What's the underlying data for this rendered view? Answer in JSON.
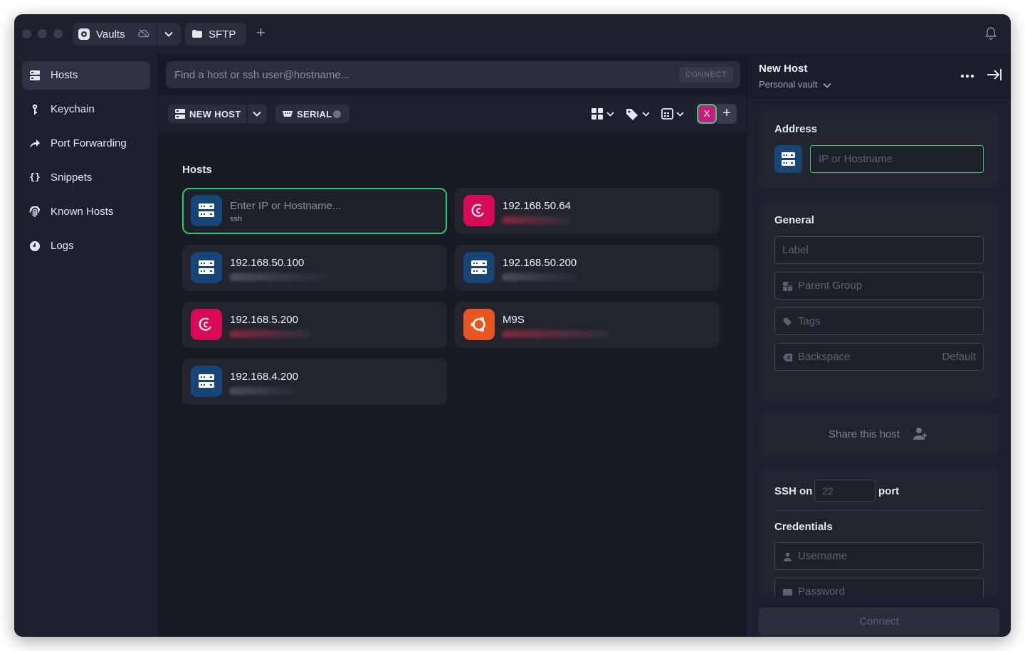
{
  "titlebar": {
    "tabs": [
      {
        "label": "Vaults",
        "icon": "vault-icon"
      },
      {
        "label": "SFTP",
        "icon": "folder-icon"
      }
    ]
  },
  "sidebar": {
    "items": [
      {
        "label": "Hosts",
        "icon": "server-icon",
        "active": true
      },
      {
        "label": "Keychain",
        "icon": "key-icon"
      },
      {
        "label": "Port Forwarding",
        "icon": "forward-arrow-icon"
      },
      {
        "label": "Snippets",
        "icon": "braces-icon"
      },
      {
        "label": "Known Hosts",
        "icon": "fingerprint-icon"
      },
      {
        "label": "Logs",
        "icon": "clock-icon"
      }
    ]
  },
  "search": {
    "placeholder": "Find a host or ssh user@hostname...",
    "connect_label": "CONNECT"
  },
  "toolbar": {
    "new_host_label": "NEW HOST",
    "serial_label": "SERIAL",
    "avatar_letter": "X"
  },
  "hosts_section": {
    "title": "Hosts",
    "cards": [
      {
        "title": "Enter IP or Hostname...",
        "subtitle": "ssh",
        "os": "server",
        "focused": true
      },
      {
        "title": "192.168.50.64",
        "subtitle": "",
        "os": "debian",
        "focused": false
      },
      {
        "title": "192.168.50.100",
        "subtitle": "",
        "os": "server",
        "focused": false
      },
      {
        "title": "192.168.50.200",
        "subtitle": "",
        "os": "server",
        "focused": false
      },
      {
        "title": "192.168.5.200",
        "subtitle": "",
        "os": "debian",
        "focused": false
      },
      {
        "title": "M9S",
        "subtitle": "",
        "os": "ubuntu",
        "focused": false
      },
      {
        "title": "192.168.4.200",
        "subtitle": "",
        "os": "server",
        "focused": false
      }
    ]
  },
  "panel": {
    "title": "New Host",
    "vault": "Personal vault",
    "address": {
      "heading": "Address",
      "placeholder": "IP or Hostname"
    },
    "general": {
      "heading": "General",
      "label_placeholder": "Label",
      "parent_group_placeholder": "Parent Group",
      "tags_placeholder": "Tags",
      "backspace_label": "Backspace",
      "backspace_value": "Default"
    },
    "share_label": "Share this host",
    "ssh": {
      "prefix": "SSH on",
      "port_placeholder": "22",
      "suffix": "port"
    },
    "credentials": {
      "heading": "Credentials",
      "username_placeholder": "Username",
      "password_placeholder": "Password"
    },
    "connect_label": "Connect"
  },
  "colors": {
    "accent_green": "#33c46f",
    "server_blue": "#164678",
    "debian_red": "#d70a53",
    "ubuntu_orange": "#e95420",
    "avatar_pink": "#c2207a"
  }
}
